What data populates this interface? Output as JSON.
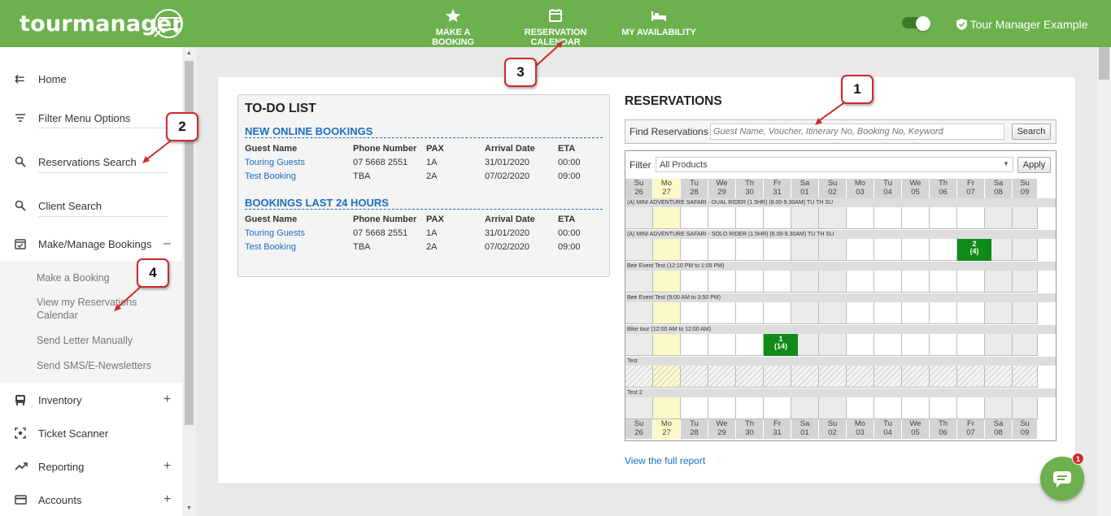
{
  "brand": {
    "logo": "tourmanager",
    "color": "#6cb14d"
  },
  "topnav": [
    {
      "label": "MAKE A BOOKING",
      "icon": "star-icon"
    },
    {
      "label": "RESERVATION CALENDAR",
      "icon": "calendar-icon"
    },
    {
      "label": "MY AVAILABILITY",
      "icon": "bed-icon"
    }
  ],
  "user": {
    "name": "Tour Manager Example"
  },
  "sidebar": {
    "items": [
      {
        "label": "Home",
        "icon": "home-arrow-icon"
      },
      {
        "label": "Filter Menu Options",
        "icon": "filter-icon"
      },
      {
        "label": "Reservations Search",
        "icon": "search-icon"
      },
      {
        "label": "Client Search",
        "icon": "search-icon"
      },
      {
        "label": "Make/Manage Bookings",
        "icon": "calendar-check-icon",
        "toggle": "–"
      },
      {
        "label": "Inventory",
        "icon": "bus-icon",
        "toggle": "+"
      },
      {
        "label": "Ticket Scanner",
        "icon": "scan-icon"
      },
      {
        "label": "Reporting",
        "icon": "trend-icon",
        "toggle": "+"
      },
      {
        "label": "Accounts",
        "icon": "card-icon",
        "toggle": "+"
      }
    ],
    "sub_items": [
      "Make a Booking",
      "View my Reservations Calendar",
      "Send Letter Manually",
      "Send SMS/E-Newsletters"
    ]
  },
  "todo": {
    "title": "TO-DO LIST",
    "sections": [
      {
        "title": "NEW ONLINE BOOKINGS",
        "headers": [
          "Guest Name",
          "Phone Number",
          "PAX",
          "Arrival Date",
          "ETA"
        ],
        "rows": [
          [
            "Touring Guests",
            "07 5668 2551",
            "1A",
            "31/01/2020",
            "00:00"
          ],
          [
            "Test Booking",
            "TBA",
            "2A",
            "07/02/2020",
            "09:00"
          ]
        ]
      },
      {
        "title": "BOOKINGS LAST 24 HOURS",
        "headers": [
          "Guest Name",
          "Phone Number",
          "PAX",
          "Arrival Date",
          "ETA"
        ],
        "rows": [
          [
            "Touring Guests",
            "07 5668 2551",
            "1A",
            "31/01/2020",
            "00:00"
          ],
          [
            "Test Booking",
            "TBA",
            "2A",
            "07/02/2020",
            "09:00"
          ]
        ]
      }
    ]
  },
  "reservations": {
    "title": "RESERVATIONS",
    "find_label": "Find Reservations",
    "find_placeholder": "Guest Name, Voucher, Itinerary No, Booking No, Keyword",
    "search_button": "Search",
    "filter_label": "Filter",
    "filter_value": "All Products",
    "apply_button": "Apply",
    "days": [
      {
        "d": "Su",
        "n": "26"
      },
      {
        "d": "Mo",
        "n": "27"
      },
      {
        "d": "Tu",
        "n": "28"
      },
      {
        "d": "We",
        "n": "29"
      },
      {
        "d": "Th",
        "n": "30"
      },
      {
        "d": "Fr",
        "n": "31"
      },
      {
        "d": "Sa",
        "n": "01"
      },
      {
        "d": "Su",
        "n": "02"
      },
      {
        "d": "Mo",
        "n": "03"
      },
      {
        "d": "Tu",
        "n": "04"
      },
      {
        "d": "We",
        "n": "05"
      },
      {
        "d": "Th",
        "n": "06"
      },
      {
        "d": "Fr",
        "n": "07"
      },
      {
        "d": "Sa",
        "n": "08"
      },
      {
        "d": "Su",
        "n": "09"
      }
    ],
    "products": [
      {
        "name": "(A) MINI ADVENTURE SAFARI - DUAL RIDER (1.5HR) (8.00-9.30AM) TU TH SU",
        "hatched": false,
        "bookings": []
      },
      {
        "name": "(A) MINI ADVENTURE SAFARI - SOLO RIDER (1.5HR) (8.00-9.30AM) TU TH SU",
        "hatched": false,
        "bookings": [
          {
            "day": 12,
            "line1": "2",
            "line2": "(4)"
          }
        ]
      },
      {
        "name": "Bee Event Test (12:10 PM to 1:05 PM)",
        "hatched": false,
        "bookings": []
      },
      {
        "name": "Bee Event Test (9:00 AM to 3:50 PM)",
        "hatched": false,
        "bookings": []
      },
      {
        "name": "Bike tour (12:00 AM to 12:00 AM)",
        "hatched": false,
        "bookings": [
          {
            "day": 5,
            "line1": "1",
            "line2": "(14)"
          }
        ]
      },
      {
        "name": "Test",
        "hatched": true,
        "bookings": []
      },
      {
        "name": "Test 2",
        "hatched": false,
        "bookings": []
      }
    ],
    "report_link": "View the full report"
  },
  "callouts": [
    "1",
    "2",
    "3",
    "4"
  ],
  "chat": {
    "badge": "1"
  }
}
